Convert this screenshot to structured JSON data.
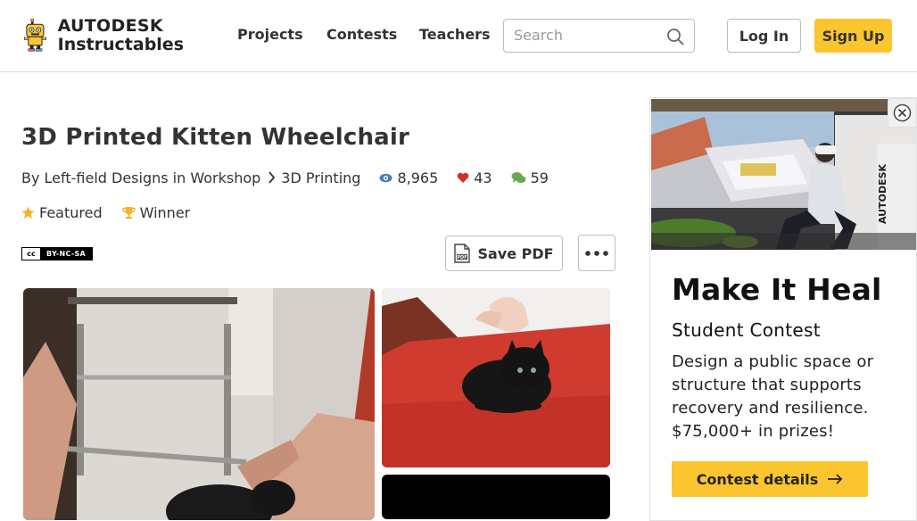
{
  "header": {
    "brand_line1": "AUTODESK",
    "brand_line2": "Instructables",
    "nav": [
      "Projects",
      "Contests",
      "Teachers"
    ],
    "search_placeholder": "Search",
    "login_label": "Log In",
    "signup_label": "Sign Up"
  },
  "article": {
    "title": "3D Printed Kitten Wheelchair",
    "author": "By Left-field Designs in Workshop",
    "category": "3D Printing",
    "views": "8,965",
    "favorites": "43",
    "comments": "59",
    "badges": [
      "Featured",
      "Winner"
    ],
    "license": "BY-NC-SA",
    "save_pdf_label": "Save PDF"
  },
  "ad": {
    "headline": "Make It Heal",
    "subheadline": "Student Contest",
    "body": "Design a public space or structure that supports recovery and resilience. $75,000+ in prizes!",
    "cta": "Contest details",
    "image_brand": "AUTODESK"
  },
  "colors": {
    "accent": "#fac52f",
    "text": "#333333",
    "views_icon": "#4a7fc1",
    "heart_icon": "#d0312d",
    "comment_icon": "#6aa84f",
    "star_icon": "#f5b427"
  },
  "icons": [
    "robot-logo-icon",
    "search-icon",
    "chevron-right-icon",
    "eye-icon",
    "heart-icon",
    "comment-icon",
    "star-icon",
    "trophy-icon",
    "pdf-icon",
    "more-icon",
    "close-icon",
    "arrow-right-icon"
  ]
}
